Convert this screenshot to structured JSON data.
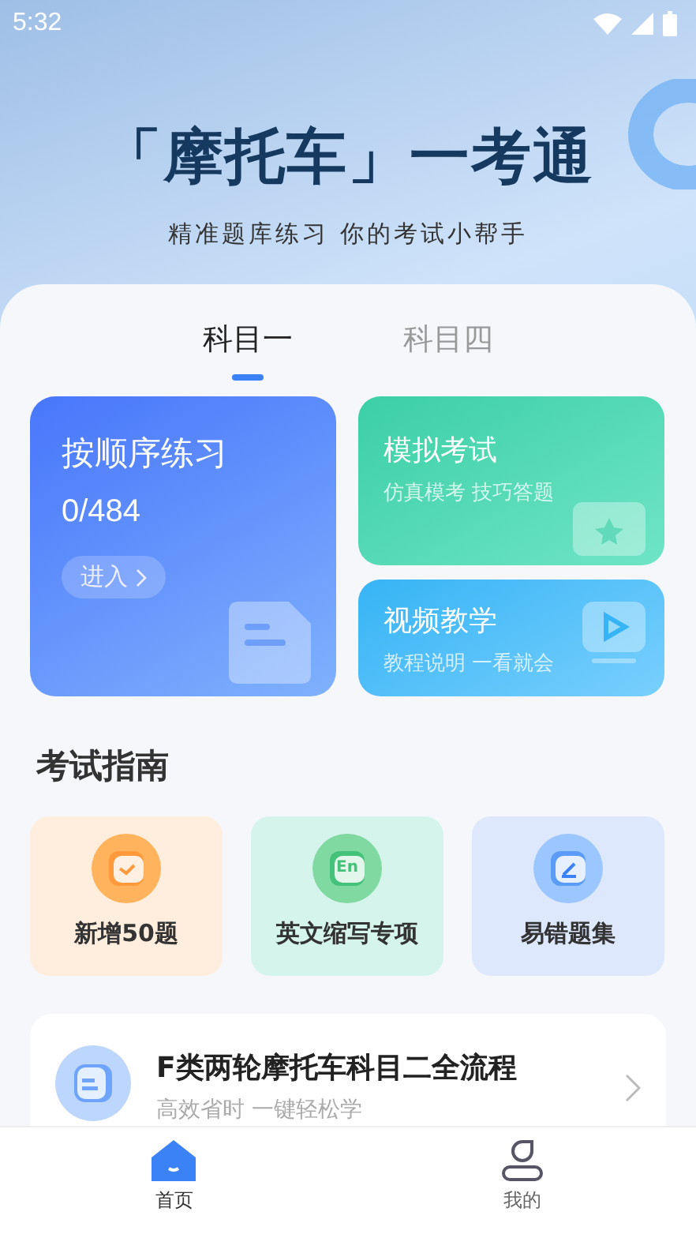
{
  "status_bar": {
    "time": "5:32"
  },
  "hero": {
    "title": "「摩托车」一考通",
    "subtitle": "精准题库练习 你的考试小帮手"
  },
  "tabs": [
    {
      "label": "科目一",
      "selected": true
    },
    {
      "label": "科目四",
      "selected": false
    }
  ],
  "practice_card": {
    "title": "按顺序练习",
    "progress": "0/484",
    "button": "进入"
  },
  "feature_cards": [
    {
      "kind": "exam",
      "title": "模拟考试",
      "subtitle": "仿真模考 技巧答题"
    },
    {
      "kind": "video",
      "title": "视频教学",
      "subtitle": "教程说明 一看就会"
    }
  ],
  "guide": {
    "title": "考试指南",
    "items": [
      {
        "kind": "calendar",
        "label": "新增50题",
        "color": "#ffeedd"
      },
      {
        "kind": "english",
        "label": "英文缩写专项",
        "badge": "En",
        "color": "#d5f5ec"
      },
      {
        "kind": "edit",
        "label": "易错题集",
        "color": "#dde8fd"
      }
    ]
  },
  "course": {
    "title": "F类两轮摩托车科目二全流程",
    "subtitle": "高效省时 一键轻松学"
  },
  "bottom_nav": [
    {
      "kind": "home",
      "label": "首页",
      "selected": true
    },
    {
      "kind": "profile",
      "label": "我的",
      "selected": false
    }
  ]
}
